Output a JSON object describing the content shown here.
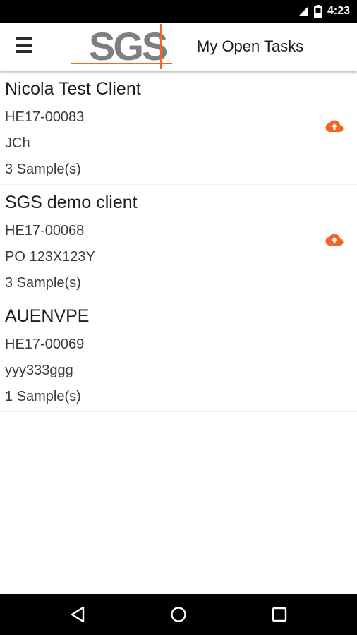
{
  "status_bar": {
    "time": "4:23",
    "icons": [
      "signal-icon",
      "battery-icon"
    ]
  },
  "app_bar": {
    "menu_icon": "hamburger-menu-icon",
    "logo_text": "SGS",
    "title": "My Open Tasks"
  },
  "colors": {
    "accent": "#f26522",
    "logo_gray": "#7f7f7f",
    "status_bar": "#000000",
    "nav_bar": "#000000"
  },
  "tasks": [
    {
      "client": "Nicola Test Client",
      "job_number": "HE17-00083",
      "reference": "JCh",
      "samples": "3 Sample(s)",
      "upload_icon": true
    },
    {
      "client": "SGS demo client",
      "job_number": "HE17-00068",
      "reference": "PO 123X123Y",
      "samples": "3 Sample(s)",
      "upload_icon": true
    },
    {
      "client": "AUENVPE",
      "job_number": "HE17-00069",
      "reference": "yyy333ggg",
      "samples": "1 Sample(s)",
      "upload_icon": false
    }
  ],
  "nav_bar": {
    "buttons": [
      "back-icon",
      "home-icon",
      "recents-icon"
    ]
  }
}
